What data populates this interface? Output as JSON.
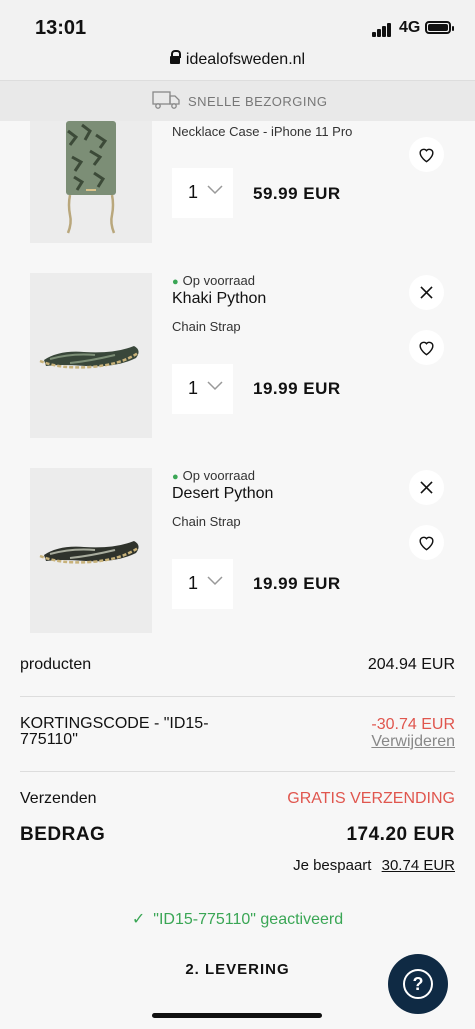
{
  "status_bar": {
    "time": "13:01",
    "network": "4G"
  },
  "browser": {
    "url": "idealofsweden.nl"
  },
  "banner": {
    "text": "SNELLE BEZORGING",
    "icon": "truck-icon"
  },
  "items": [
    {
      "type": "Necklace Case - iPhone 11 Pro",
      "quantity": "1",
      "price": "59.99 EUR"
    },
    {
      "stock": "Op voorraad",
      "name": "Khaki Python",
      "type": "Chain Strap",
      "quantity": "1",
      "price": "19.99 EUR"
    },
    {
      "stock": "Op voorraad",
      "name": "Desert Python",
      "type": "Chain Strap",
      "quantity": "1",
      "price": "19.99 EUR"
    }
  ],
  "summary": {
    "products_label": "producten",
    "products_value": "204.94 EUR",
    "discount_label_line1": "KORTINGSCODE - \"ID15-",
    "discount_label_line2": "775110\"",
    "discount_value": "-30.74 EUR",
    "remove_label": "Verwijderen",
    "shipping_label": "Verzenden",
    "shipping_value": "GRATIS VERZENDING",
    "total_label": "BEDRAG",
    "total_value": "174.20 EUR",
    "savings_label": "Je bespaart",
    "savings_value": "30.74 EUR"
  },
  "coupon_status": "\"ID15-775110\" geactiveerd",
  "next_step": "2. LEVERING",
  "help_button": {
    "icon": "question-icon",
    "label": "?"
  },
  "colors": {
    "accent_red": "#e0564e",
    "stock_green": "#3aa655",
    "help_bg": "#0f2a44"
  }
}
